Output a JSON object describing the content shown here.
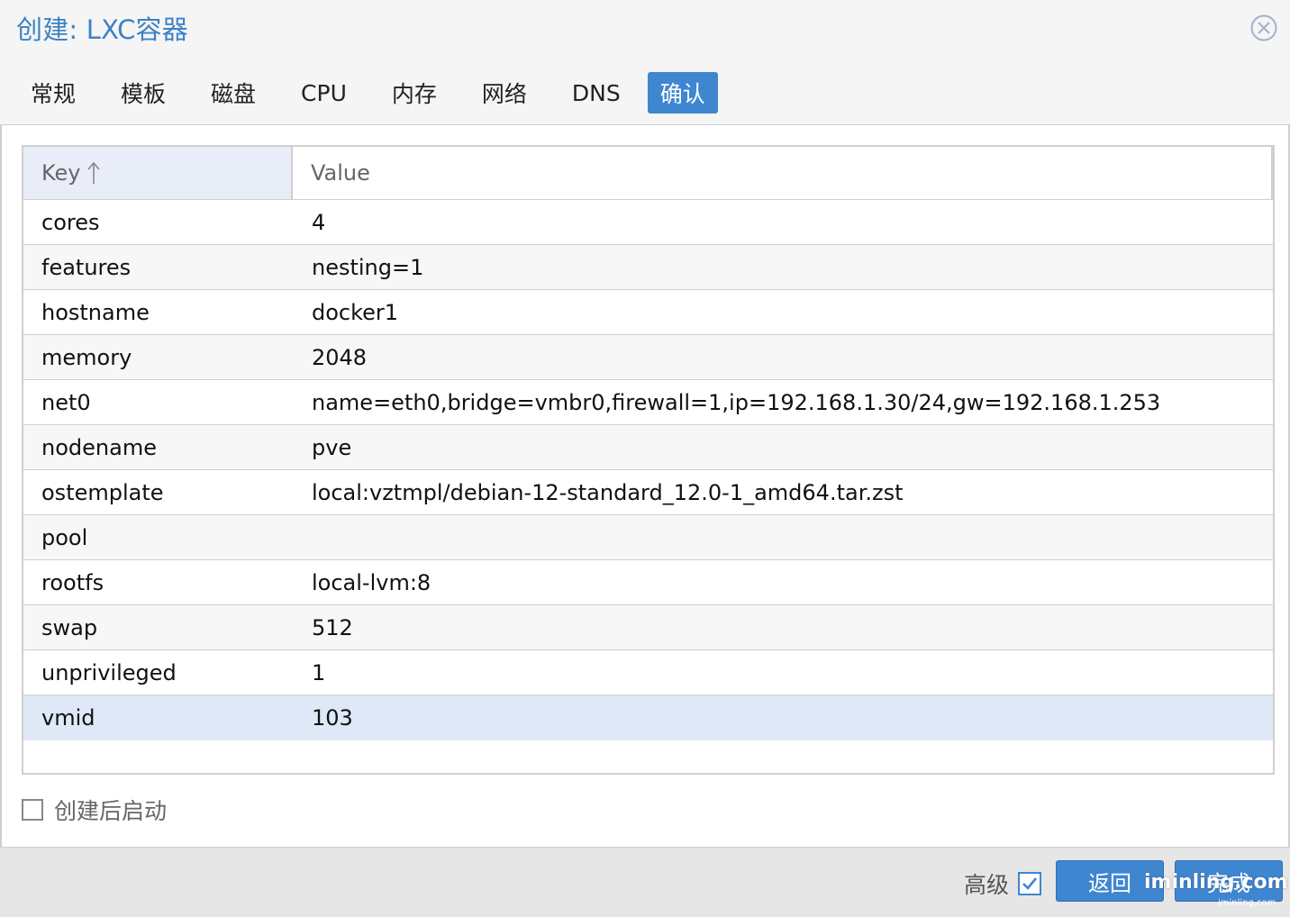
{
  "window": {
    "title": "创建: LXC容器",
    "close_icon": "close-circle-icon"
  },
  "tabs": [
    {
      "label": "常规",
      "active": false
    },
    {
      "label": "模板",
      "active": false
    },
    {
      "label": "磁盘",
      "active": false
    },
    {
      "label": "CPU",
      "active": false
    },
    {
      "label": "内存",
      "active": false
    },
    {
      "label": "网络",
      "active": false
    },
    {
      "label": "DNS",
      "active": false
    },
    {
      "label": "确认",
      "active": true
    }
  ],
  "grid": {
    "columns": {
      "key": "Key",
      "value": "Value"
    },
    "sort_icon": "sort-ascending-arrow-icon",
    "rows": [
      {
        "key": "cores",
        "value": "4"
      },
      {
        "key": "features",
        "value": "nesting=1"
      },
      {
        "key": "hostname",
        "value": "docker1"
      },
      {
        "key": "memory",
        "value": "2048"
      },
      {
        "key": "net0",
        "value": "name=eth0,bridge=vmbr0,firewall=1,ip=192.168.1.30/24,gw=192.168.1.253"
      },
      {
        "key": "nodename",
        "value": "pve"
      },
      {
        "key": "ostemplate",
        "value": "local:vztmpl/debian-12-standard_12.0-1_amd64.tar.zst"
      },
      {
        "key": "pool",
        "value": ""
      },
      {
        "key": "rootfs",
        "value": "local-lvm:8"
      },
      {
        "key": "swap",
        "value": "512"
      },
      {
        "key": "unprivileged",
        "value": "1"
      },
      {
        "key": "vmid",
        "value": "103"
      }
    ],
    "selected_row": "vmid"
  },
  "start_after_create": {
    "label": "创建后启动",
    "checked": false
  },
  "footer": {
    "advanced_label": "高级",
    "advanced_checked": true,
    "back_label": "返回",
    "finish_label": "完成",
    "watermark": "iminling.com",
    "watermark_small": "iminling.com"
  },
  "colors": {
    "accent": "#3f86d1",
    "title": "#3d82c4",
    "header_bg": "#e8edf8",
    "selected_row": "#dfe8f6"
  }
}
